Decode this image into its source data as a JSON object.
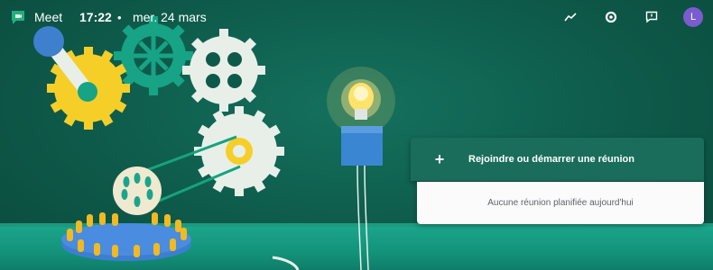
{
  "topbar": {
    "app_name": "Meet",
    "time": "17:22",
    "separator": "•",
    "date": "mer. 24 mars",
    "avatar_initial": "L"
  },
  "meetings": {
    "join_icon": "+",
    "join_label": "Rejoindre ou démarrer une réunion",
    "empty_label": "Aucune réunion planifiée aujourd'hui"
  },
  "colors": {
    "background": "#0f5d4d",
    "floor": "#13927a",
    "accent_avatar": "#7a5ccf",
    "join_panel": "#1a6d5b"
  }
}
